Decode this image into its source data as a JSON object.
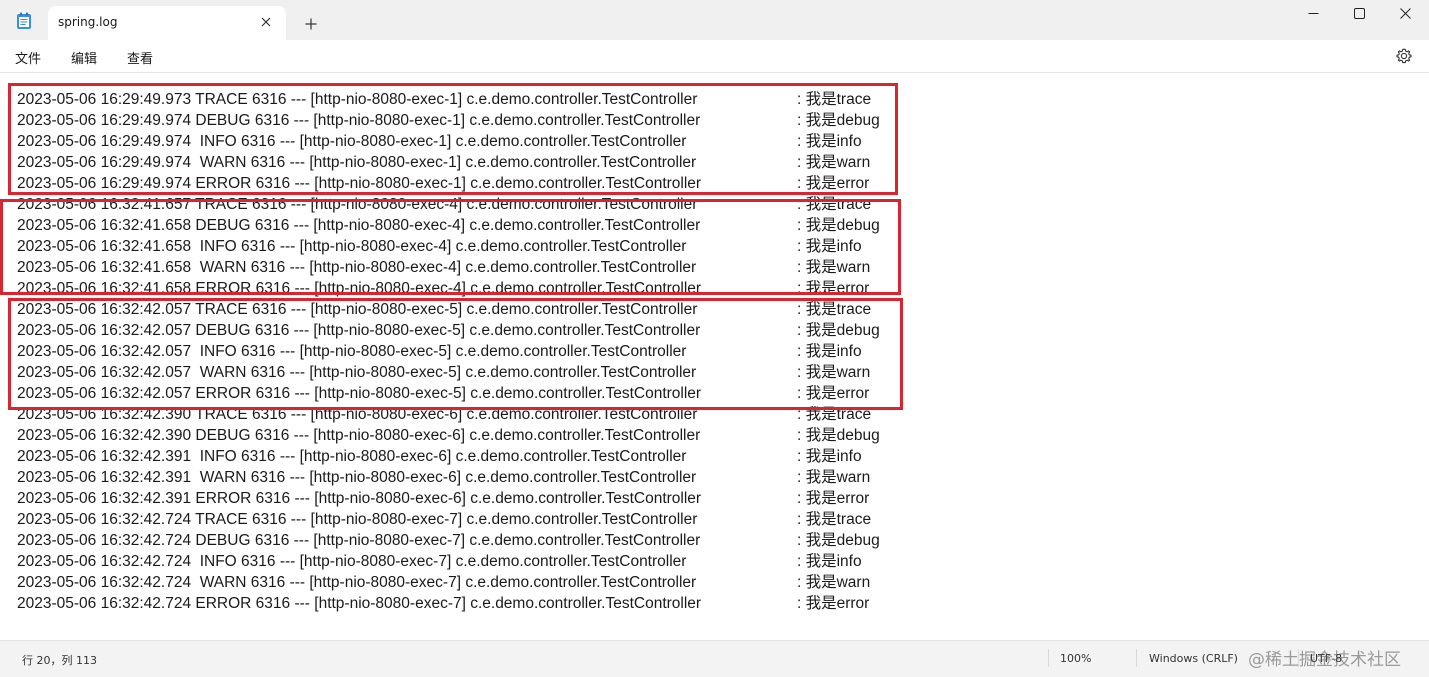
{
  "window": {
    "tab_title": "spring.log",
    "new_tab_symbol": "+",
    "app_icon": "notepad-icon"
  },
  "menu": {
    "file": "文件",
    "edit": "编辑",
    "view": "查看",
    "settings_icon": "gear-icon"
  },
  "log": {
    "lines": [
      {
        "prefix": "2023-05-06 16:29:49.973 TRACE 6316 --- [http-nio-8080-exec-1] c.e.demo.controller.TestController",
        "msg": ": 我是trace"
      },
      {
        "prefix": "2023-05-06 16:29:49.974 DEBUG 6316 --- [http-nio-8080-exec-1] c.e.demo.controller.TestController",
        "msg": ": 我是debug"
      },
      {
        "prefix": "2023-05-06 16:29:49.974  INFO 6316 --- [http-nio-8080-exec-1] c.e.demo.controller.TestController",
        "msg": ": 我是info"
      },
      {
        "prefix": "2023-05-06 16:29:49.974  WARN 6316 --- [http-nio-8080-exec-1] c.e.demo.controller.TestController",
        "msg": ": 我是warn"
      },
      {
        "prefix": "2023-05-06 16:29:49.974 ERROR 6316 --- [http-nio-8080-exec-1] c.e.demo.controller.TestController",
        "msg": ": 我是error"
      },
      {
        "prefix": "2023-05-06 16:32:41.657 TRACE 6316 --- [http-nio-8080-exec-4] c.e.demo.controller.TestController",
        "msg": ": 我是trace"
      },
      {
        "prefix": "2023-05-06 16:32:41.658 DEBUG 6316 --- [http-nio-8080-exec-4] c.e.demo.controller.TestController",
        "msg": ": 我是debug"
      },
      {
        "prefix": "2023-05-06 16:32:41.658  INFO 6316 --- [http-nio-8080-exec-4] c.e.demo.controller.TestController",
        "msg": ": 我是info"
      },
      {
        "prefix": "2023-05-06 16:32:41.658  WARN 6316 --- [http-nio-8080-exec-4] c.e.demo.controller.TestController",
        "msg": ": 我是warn"
      },
      {
        "prefix": "2023-05-06 16:32:41.658 ERROR 6316 --- [http-nio-8080-exec-4] c.e.demo.controller.TestController",
        "msg": ": 我是error"
      },
      {
        "prefix": "2023-05-06 16:32:42.057 TRACE 6316 --- [http-nio-8080-exec-5] c.e.demo.controller.TestController",
        "msg": ": 我是trace"
      },
      {
        "prefix": "2023-05-06 16:32:42.057 DEBUG 6316 --- [http-nio-8080-exec-5] c.e.demo.controller.TestController",
        "msg": ": 我是debug"
      },
      {
        "prefix": "2023-05-06 16:32:42.057  INFO 6316 --- [http-nio-8080-exec-5] c.e.demo.controller.TestController",
        "msg": ": 我是info"
      },
      {
        "prefix": "2023-05-06 16:32:42.057  WARN 6316 --- [http-nio-8080-exec-5] c.e.demo.controller.TestController",
        "msg": ": 我是warn"
      },
      {
        "prefix": "2023-05-06 16:32:42.057 ERROR 6316 --- [http-nio-8080-exec-5] c.e.demo.controller.TestController",
        "msg": ": 我是error"
      },
      {
        "prefix": "2023-05-06 16:32:42.390 TRACE 6316 --- [http-nio-8080-exec-6] c.e.demo.controller.TestController",
        "msg": ": 我是trace"
      },
      {
        "prefix": "2023-05-06 16:32:42.390 DEBUG 6316 --- [http-nio-8080-exec-6] c.e.demo.controller.TestController",
        "msg": ": 我是debug"
      },
      {
        "prefix": "2023-05-06 16:32:42.391  INFO 6316 --- [http-nio-8080-exec-6] c.e.demo.controller.TestController",
        "msg": ": 我是info"
      },
      {
        "prefix": "2023-05-06 16:32:42.391  WARN 6316 --- [http-nio-8080-exec-6] c.e.demo.controller.TestController",
        "msg": ": 我是warn"
      },
      {
        "prefix": "2023-05-06 16:32:42.391 ERROR 6316 --- [http-nio-8080-exec-6] c.e.demo.controller.TestController",
        "msg": ": 我是error"
      },
      {
        "prefix": "2023-05-06 16:32:42.724 TRACE 6316 --- [http-nio-8080-exec-7] c.e.demo.controller.TestController",
        "msg": ": 我是trace"
      },
      {
        "prefix": "2023-05-06 16:32:42.724 DEBUG 6316 --- [http-nio-8080-exec-7] c.e.demo.controller.TestController",
        "msg": ": 我是debug"
      },
      {
        "prefix": "2023-05-06 16:32:42.724  INFO 6316 --- [http-nio-8080-exec-7] c.e.demo.controller.TestController",
        "msg": ": 我是info"
      },
      {
        "prefix": "2023-05-06 16:32:42.724  WARN 6316 --- [http-nio-8080-exec-7] c.e.demo.controller.TestController",
        "msg": ": 我是warn"
      },
      {
        "prefix": "2023-05-06 16:32:42.724 ERROR 6316 --- [http-nio-8080-exec-7] c.e.demo.controller.TestController",
        "msg": ": 我是error"
      }
    ],
    "highlight_color": "#d9252f"
  },
  "status": {
    "position": "行 20，列 113",
    "zoom": "100%",
    "line_ending": "Windows (CRLF)",
    "encoding": "UTF-8",
    "watermark": "@稀土掘金技术社区"
  }
}
